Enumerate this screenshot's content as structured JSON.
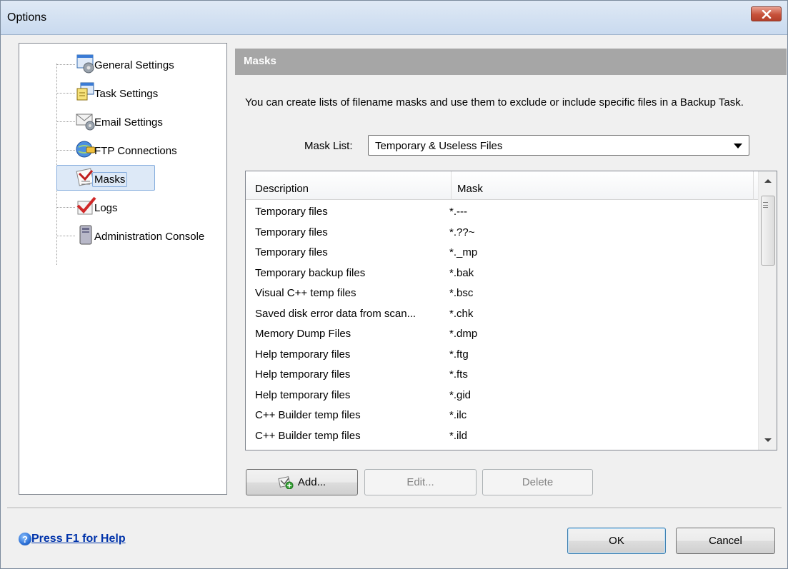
{
  "window": {
    "title": "Options"
  },
  "tree": {
    "items": [
      {
        "label": "General Settings",
        "icon": "gear-window-icon"
      },
      {
        "label": "Task Settings",
        "icon": "task-window-icon"
      },
      {
        "label": "Email Settings",
        "icon": "email-gear-icon"
      },
      {
        "label": "FTP Connections",
        "icon": "ftp-globe-icon"
      },
      {
        "label": "Masks",
        "icon": "masks-icon",
        "selected": true
      },
      {
        "label": "Logs",
        "icon": "logs-checkmark-icon"
      },
      {
        "label": "Administration Console",
        "icon": "computer-icon"
      }
    ]
  },
  "masks": {
    "header": "Masks",
    "description": "You can create lists of filename masks and use them to exclude or include specific files in a Backup Task.",
    "mask_list_label": "Mask List:",
    "mask_list_value": "Temporary & Useless Files",
    "columns": {
      "description": "Description",
      "mask": "Mask"
    },
    "rows": [
      {
        "description": "Temporary files",
        "mask": "*.---"
      },
      {
        "description": "Temporary files",
        "mask": "*.??~"
      },
      {
        "description": "Temporary files",
        "mask": "*._mp"
      },
      {
        "description": "Temporary backup files",
        "mask": "*.bak"
      },
      {
        "description": "Visual C++ temp files",
        "mask": "*.bsc"
      },
      {
        "description": "Saved disk error data from scan...",
        "mask": "*.chk"
      },
      {
        "description": "Memory Dump Files",
        "mask": "*.dmp"
      },
      {
        "description": "Help temporary files",
        "mask": "*.ftg"
      },
      {
        "description": "Help temporary files",
        "mask": "*.fts"
      },
      {
        "description": "Help temporary files",
        "mask": "*.gid"
      },
      {
        "description": "C++ Builder temp files",
        "mask": "*.ilc"
      },
      {
        "description": "C++ Builder temp files",
        "mask": "*.ild"
      }
    ],
    "buttons": {
      "add": "Add...",
      "edit": "Edit...",
      "delete": "Delete"
    }
  },
  "footer": {
    "help_link": "Press F1 for Help",
    "ok": "OK",
    "cancel": "Cancel"
  },
  "colors": {
    "section_header_bg": "#a6a6a6",
    "selection_bg": "#dde9f7",
    "link": "#0033aa",
    "close_button": "#c7513a"
  }
}
